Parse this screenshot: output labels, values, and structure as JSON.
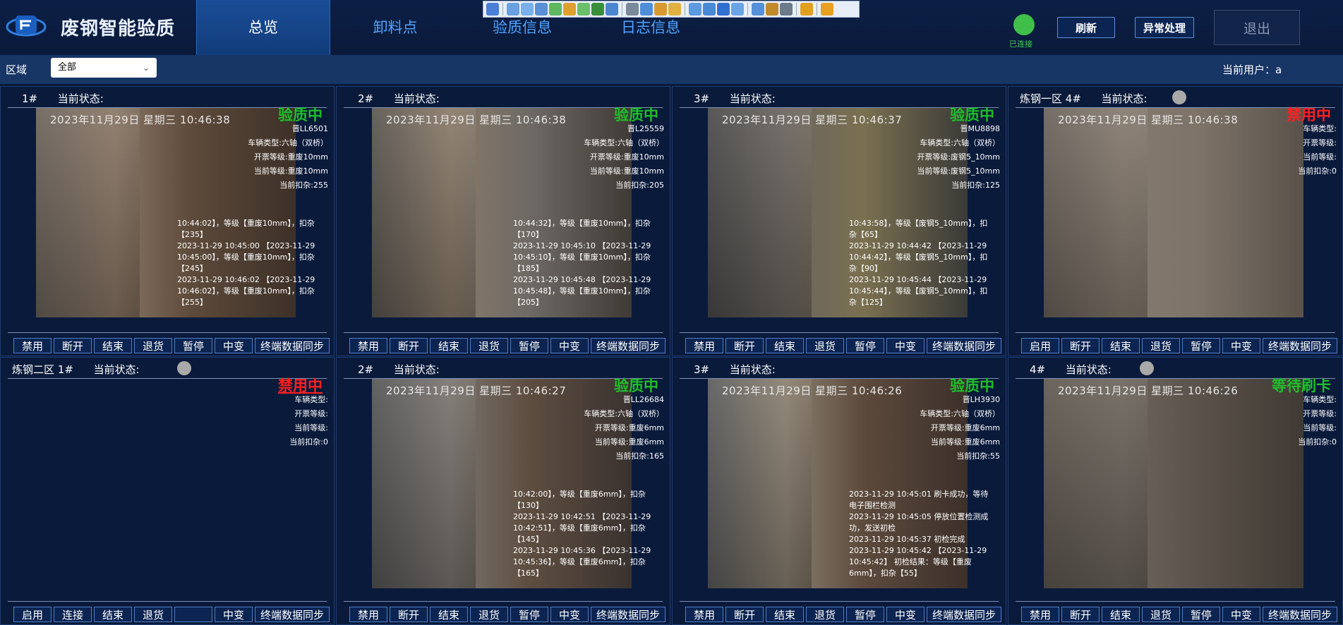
{
  "app": {
    "title": "废钢智能验质"
  },
  "nav": {
    "tabs": [
      "总览",
      "卸料点",
      "验质信息",
      "日志信息"
    ]
  },
  "header": {
    "connection_label": "已连接",
    "refresh_label": "刷新",
    "exception_label": "异常处理",
    "logout_label": "退出"
  },
  "filter": {
    "area_label": "区域",
    "area_value": "全部",
    "user_label": "当前用户：",
    "user_value": "a"
  },
  "labels": {
    "current_status": "当前状态:",
    "vehicle_type": "车辆类型:",
    "invoice_grade": "开票等级:",
    "current_grade": "当前等级:",
    "current_deduct": "当前扣杂:"
  },
  "panels": [
    {
      "zone": "",
      "num": "1#",
      "timestamp": "2023年11月29日  星期三  10:46:38",
      "status": "验质中",
      "status_color": "#1fbf2a",
      "plate": "晋LL6501",
      "vehicle_type": "车辆类型:六轴（双桥）",
      "invoice_grade": "开票等级:重废10mm",
      "current_grade": "当前等级:重废10mm",
      "current_deduct": "当前扣杂:255",
      "log": "10:44:02】，等级【重废10mm】，扣杂【235】\n2023-11-29 10:45:00 【2023-11-29 10:45:00】，等级【重废10mm】，扣杂【245】\n2023-11-29 10:46:02 【2023-11-29 10:46:02】，等级【重废10mm】，扣杂【255】",
      "buttons": [
        "禁用",
        "断开",
        "结束",
        "退货",
        "暂停",
        "中变",
        "终端数据同步"
      ]
    },
    {
      "zone": "",
      "num": "2#",
      "timestamp": "2023年11月29日  星期三  10:46:38",
      "status": "验质中",
      "status_color": "#1fbf2a",
      "plate": "晋L25559",
      "vehicle_type": "车辆类型:六轴（双桥）",
      "invoice_grade": "开票等级:重废10mm",
      "current_grade": "当前等级:重废10mm",
      "current_deduct": "当前扣杂:205",
      "log": "10:44:32】，等级【重废10mm】，扣杂【170】\n2023-11-29 10:45:10 【2023-11-29 10:45:10】，等级【重废10mm】，扣杂【185】\n2023-11-29 10:45:48 【2023-11-29 10:45:48】，等级【重废10mm】，扣杂【205】",
      "buttons": [
        "禁用",
        "断开",
        "结束",
        "退货",
        "暂停",
        "中变",
        "终端数据同步"
      ]
    },
    {
      "zone": "",
      "num": "3#",
      "timestamp": "2023年11月29日  星期三  10:46:37",
      "status": "验质中",
      "status_color": "#1fbf2a",
      "plate": "晋MU8898",
      "vehicle_type": "车辆类型:六轴（双桥）",
      "invoice_grade": "开票等级:废钢5_10mm",
      "current_grade": "当前等级:废钢5_10mm",
      "current_deduct": "当前扣杂:125",
      "log": "10:43:58】，等级【废钢5_10mm】，扣杂【65】\n2023-11-29 10:44:42 【2023-11-29 10:44:42】，等级【废钢5_10mm】，扣杂【90】\n2023-11-29 10:45:44 【2023-11-29 10:45:44】，等级【废钢5_10mm】，扣杂【125】",
      "buttons": [
        "禁用",
        "断开",
        "结束",
        "退货",
        "暂停",
        "中变",
        "终端数据同步"
      ]
    },
    {
      "zone": "炼钢一区",
      "num": "4#",
      "timestamp": "2023年11月29日  星期三  10:46:38",
      "status": "禁用中",
      "status_color": "#ff2020",
      "plate": "",
      "vehicle_type": "车辆类型:",
      "invoice_grade": "开票等级:",
      "current_grade": "当前等级:",
      "current_deduct": "当前扣杂:0",
      "log": "",
      "buttons": [
        "启用",
        "断开",
        "结束",
        "退货",
        "暂停",
        "中变",
        "终端数据同步"
      ]
    },
    {
      "zone": "炼钢二区",
      "num": "1#",
      "timestamp": "",
      "status": "禁用中",
      "status_color": "#ff2020",
      "plate": "",
      "vehicle_type": "车辆类型:",
      "invoice_grade": "开票等级:",
      "current_grade": "当前等级:",
      "current_deduct": "当前扣杂:0",
      "log": "",
      "buttons": [
        "启用",
        "连接",
        "结束",
        "退货",
        "",
        "中变",
        "终端数据同步"
      ]
    },
    {
      "zone": "",
      "num": "2#",
      "timestamp": "2023年11月29日  星期三  10:46:27",
      "status": "验质中",
      "status_color": "#1fbf2a",
      "plate": "晋LL26684",
      "vehicle_type": "车辆类型:六轴（双桥）",
      "invoice_grade": "开票等级:重废6mm",
      "current_grade": "当前等级:重废6mm",
      "current_deduct": "当前扣杂:165",
      "log": "10:42:00】，等级【重废6mm】，扣杂【130】\n2023-11-29 10:42:51 【2023-11-29 10:42:51】，等级【重废6mm】，扣杂【145】\n2023-11-29 10:45:36 【2023-11-29 10:45:36】，等级【重废6mm】，扣杂【165】",
      "buttons": [
        "禁用",
        "断开",
        "结束",
        "退货",
        "暂停",
        "中变",
        "终端数据同步"
      ]
    },
    {
      "zone": "",
      "num": "3#",
      "timestamp": "2023年11月29日  星期三  10:46:26",
      "status": "验质中",
      "status_color": "#1fbf2a",
      "plate": "晋LH3930",
      "vehicle_type": "车辆类型:六轴（双桥）",
      "invoice_grade": "开票等级:重废6mm",
      "current_grade": "当前等级:重废6mm",
      "current_deduct": "当前扣杂:55",
      "log": "2023-11-29 10:45:01 刷卡成功，等待电子围栏检测\n2023-11-29 10:45:05 停放位置检测成功，发送初检\n2023-11-29 10:45:37 初检完成\n2023-11-29 10:45:42 【2023-11-29 10:45:42】 初检结果：等级【重废6mm】，扣杂【55】",
      "buttons": [
        "禁用",
        "断开",
        "结束",
        "退货",
        "暂停",
        "中变",
        "终端数据同步"
      ]
    },
    {
      "zone": "",
      "num": "4#",
      "timestamp": "2023年11月29日  星期三  10:46:26",
      "status": "等待刷卡",
      "status_color": "#1fbf2a",
      "plate": "",
      "vehicle_type": "车辆类型:",
      "invoice_grade": "开票等级:",
      "current_grade": "当前等级:",
      "current_deduct": "当前扣杂:0",
      "log": "",
      "buttons": [
        "禁用",
        "断开",
        "结束",
        "退货",
        "暂停",
        "中变",
        "终端数据同步"
      ]
    }
  ]
}
